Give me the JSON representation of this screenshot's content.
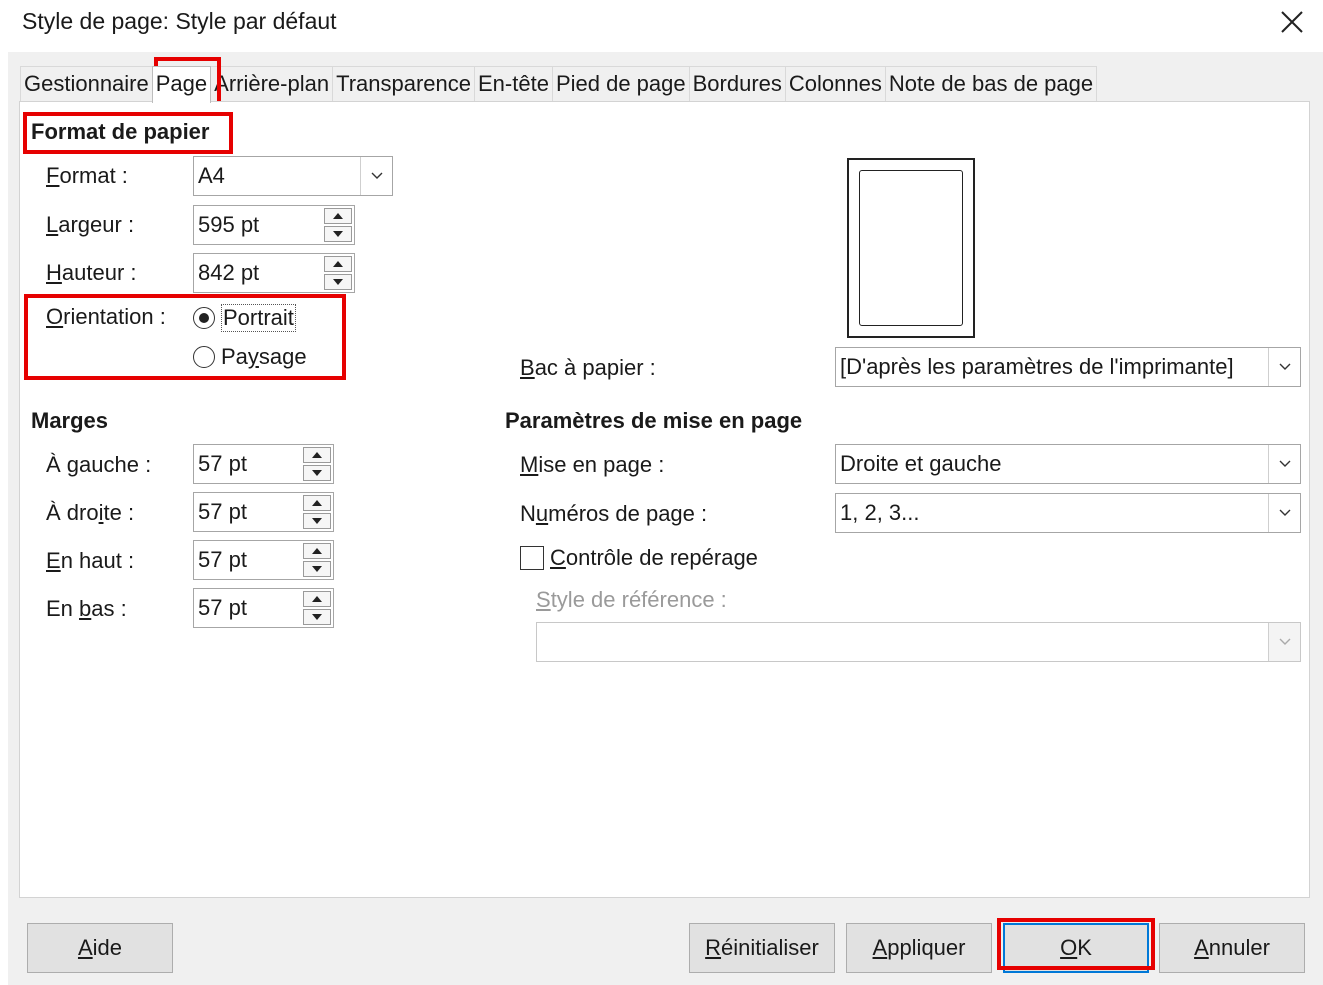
{
  "window": {
    "title": "Style de page: Style par défaut",
    "close_icon": "close-icon"
  },
  "tabs": [
    {
      "label": "Gestionnaire",
      "active": false
    },
    {
      "label": "Page",
      "active": true
    },
    {
      "label": "Arrière-plan",
      "active": false
    },
    {
      "label": "Transparence",
      "active": false
    },
    {
      "label": "En-tête",
      "active": false
    },
    {
      "label": "Pied de page",
      "active": false
    },
    {
      "label": "Bordures",
      "active": false
    },
    {
      "label": "Colonnes",
      "active": false
    },
    {
      "label": "Note de bas de page",
      "active": false
    }
  ],
  "paper_format": {
    "heading": "Format de papier",
    "format": {
      "label_first": "F",
      "label_rest": "ormat :",
      "value": "A4"
    },
    "width": {
      "label_first": "L",
      "label_rest": "argeur :",
      "value": "595 pt"
    },
    "height": {
      "label_first": "H",
      "label_rest": "auteur :",
      "value": "842 pt"
    },
    "orientation": {
      "label_first": "O",
      "label_rest": "rientation :",
      "portrait_label": "Portrait",
      "portrait_checked": true,
      "landscape_pre": "Pa",
      "landscape_u": "y",
      "landscape_post": "sage",
      "landscape_checked": false
    },
    "paper_tray": {
      "label_first": "B",
      "label_rest": "ac à papier :",
      "value": "[D'après les paramètres de l'imprimante]"
    }
  },
  "margins": {
    "heading": "Marges",
    "left": {
      "label_pre": "À ",
      "label_u": "g",
      "label_post": "auche :",
      "value": "57 pt"
    },
    "right": {
      "label_pre": "À dro",
      "label_u": "i",
      "label_post": "te :",
      "value": "57 pt"
    },
    "top": {
      "label_pre": "",
      "label_u": "E",
      "label_post": "n haut :",
      "value": "57 pt"
    },
    "bottom": {
      "label_pre": "En ",
      "label_u": "b",
      "label_post": "as :",
      "value": "57 pt"
    }
  },
  "layout_settings": {
    "heading": "Paramètres de mise en page",
    "page_layout": {
      "label_first": "M",
      "label_rest": "ise en page :",
      "value": "Droite et gauche"
    },
    "page_numbers": {
      "label_pre": "N",
      "label_u": "u",
      "label_post": "méros de page :",
      "value": "1, 2, 3..."
    },
    "register_true": {
      "label_first": "C",
      "label_rest": "ontrôle de repérage",
      "checked": false
    },
    "reference_style": {
      "label_first": "S",
      "label_rest": "tyle de référence :",
      "value": ""
    }
  },
  "buttons": {
    "help": {
      "first": "A",
      "rest": "ide"
    },
    "reset": {
      "first": "R",
      "rest": "éinitialiser"
    },
    "apply": {
      "first": "A",
      "rest": "ppliquer"
    },
    "ok": {
      "first": "O",
      "rest": "K"
    },
    "cancel": {
      "first": "A",
      "rest": "nnuler"
    }
  },
  "highlight_color": "#e60000"
}
